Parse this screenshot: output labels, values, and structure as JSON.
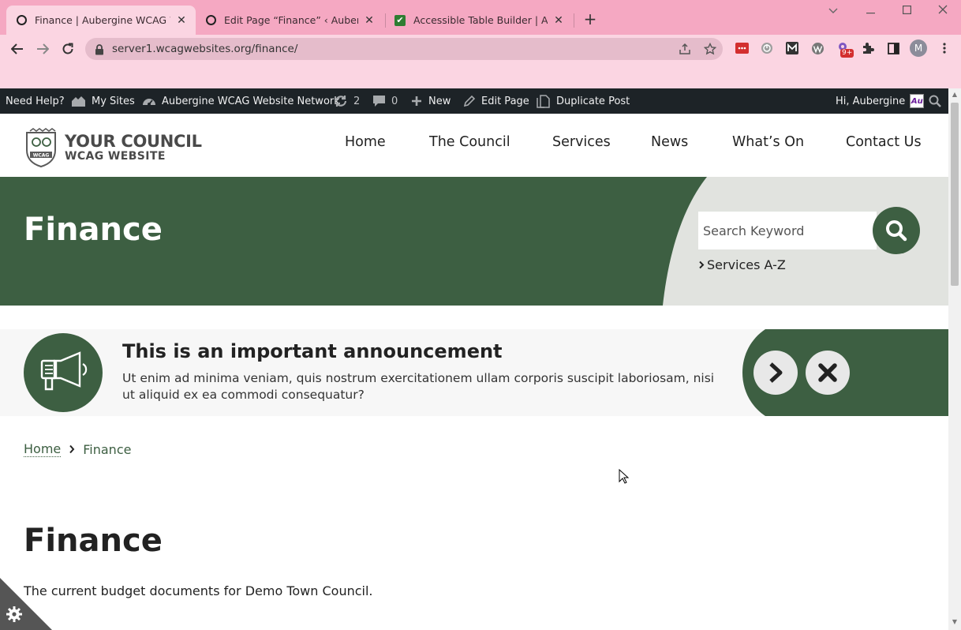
{
  "browser": {
    "tabs": [
      {
        "title": "Finance | Aubergine WCAG Webs",
        "active": true,
        "icon": "circle-icon"
      },
      {
        "title": "Edit Page “Finance” ‹ Aubergine W",
        "active": false,
        "icon": "circle-icon"
      },
      {
        "title": "Accessible Table Builder | Accessi",
        "active": false,
        "icon": "checkmark-icon"
      }
    ],
    "url": "server1.wcagwebsites.org/finance/",
    "extension_badge": "9+",
    "profile_initial": "M"
  },
  "adminbar": {
    "need_help": "Need Help?",
    "my_sites": "My Sites",
    "network": "Aubergine WCAG Website Network",
    "updates_count": "2",
    "comments_count": "0",
    "new": "New",
    "edit_page": "Edit Page",
    "duplicate_post": "Duplicate Post",
    "greeting": "Hi, Aubergine"
  },
  "site": {
    "logo_line1": "YOUR COUNCIL",
    "logo_line2": "WCAG WEBSITE",
    "logo_badge": "WCAG",
    "nav": [
      "Home",
      "The Council",
      "Services",
      "News",
      "What’s On",
      "Contact Us"
    ]
  },
  "hero": {
    "title": "Finance",
    "search_placeholder": "Search Keyword",
    "az_link": "Services A-Z"
  },
  "announcement": {
    "title": "This is an important announcement",
    "body": "Ut enim ad minima veniam, quis nostrum exercitationem ullam corporis suscipit laboriosam, nisi ut aliquid ex ea commodi consequatur?"
  },
  "breadcrumb": {
    "home": "Home",
    "current": "Finance"
  },
  "content": {
    "title": "Finance",
    "intro": "The current budget documents for Demo Town Council."
  },
  "colors": {
    "brand_green": "#3d5f42",
    "chrome_pink": "#f5a8c2",
    "admin_bar": "#1d2327"
  }
}
